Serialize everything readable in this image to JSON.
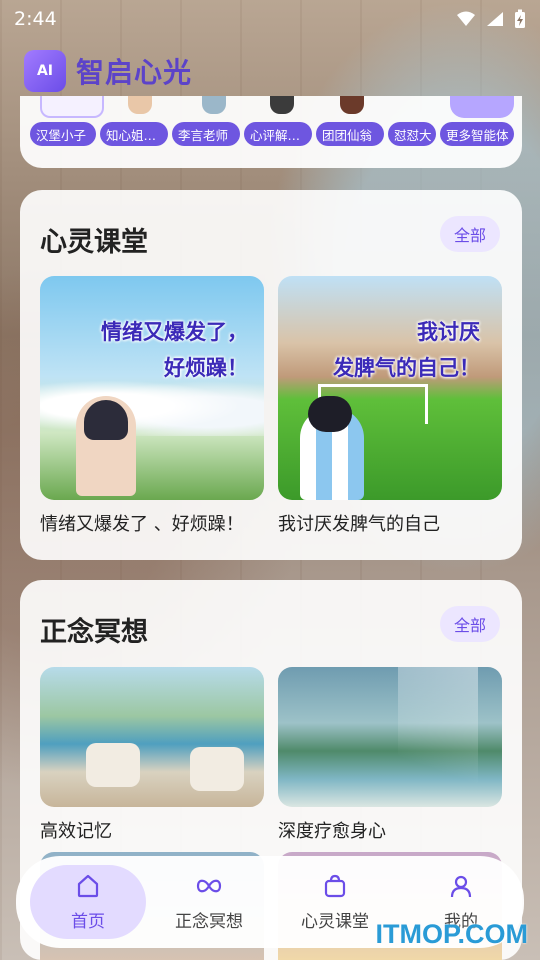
{
  "status_bar": {
    "time": "2:44"
  },
  "app": {
    "logo_text": "AI",
    "title": "智启心光"
  },
  "agents": [
    "汉堡小子",
    "知心姐…",
    "李言老师",
    "心评解…",
    "团团仙翁",
    "怼怼大",
    "更多智能体"
  ],
  "sections": [
    {
      "title": "心灵课堂",
      "all_label": "全部",
      "items": [
        {
          "thumb_title": "情绪又爆发了，\n好烦躁！",
          "caption": "情绪又爆发了 、好烦躁！"
        },
        {
          "thumb_title": "我讨厌\n发脾气的自己！",
          "caption": "我讨厌发脾气的自己"
        }
      ]
    },
    {
      "title": "正念冥想",
      "all_label": "全部",
      "items": [
        {
          "caption": "高效记忆"
        },
        {
          "caption": "深度疗愈身心"
        }
      ]
    }
  ],
  "nav": [
    {
      "label": "首页",
      "icon": "home-icon",
      "active": true
    },
    {
      "label": "正念冥想",
      "icon": "infinity-icon",
      "active": false
    },
    {
      "label": "心灵课堂",
      "icon": "bag-icon",
      "active": false
    },
    {
      "label": "我的",
      "icon": "user-icon",
      "active": false
    }
  ],
  "watermark": "ITMOP.COM"
}
